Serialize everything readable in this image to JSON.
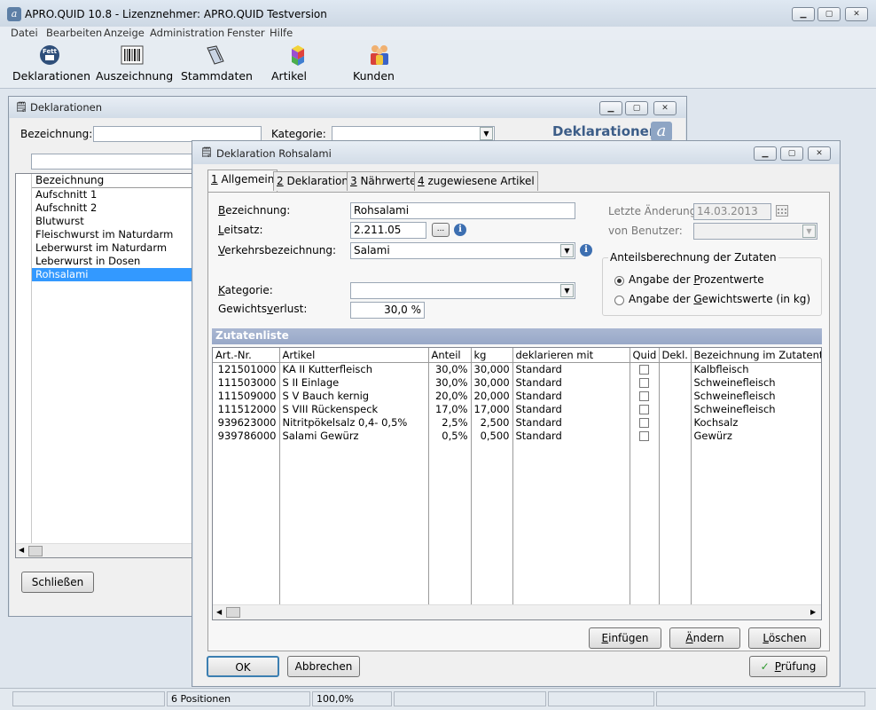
{
  "app": {
    "title": "APRO.QUID 10.8 - Lizenznehmer: APRO.QUID Testversion",
    "icon_letter": "a"
  },
  "menu": [
    "Datei",
    "Bearbeiten",
    "Anzeige",
    "Administration",
    "Fenster",
    "Hilfe"
  ],
  "toolbar": [
    {
      "label": "Deklarationen",
      "icon": "fett-badge-icon"
    },
    {
      "label": "Auszeichnung",
      "icon": "barcode-icon"
    },
    {
      "label": "Stammdaten",
      "icon": "folder-tag-icon"
    },
    {
      "label": "Artikel",
      "icon": "cubes-icon"
    },
    {
      "label": "Kunden",
      "icon": "people-icon"
    }
  ],
  "list_window": {
    "title": "Deklarationen",
    "bezeichnung_label": "Bezeichnung:",
    "kategorie_label": "Kategorie:",
    "brand_text": "Deklarationen",
    "column_header": "Bezeichnung",
    "items": [
      "Aufschnitt 1",
      "Aufschnitt 2",
      "Blutwurst",
      "Fleischwurst im Naturdarm",
      "Leberwurst im Naturdarm",
      "Leberwurst in Dosen",
      "Rohsalami"
    ],
    "selected_index": 6,
    "close_button": "Schließen"
  },
  "dialog": {
    "title": "Deklaration Rohsalami",
    "tabs": [
      {
        "key": "1",
        "label": " Allgemein"
      },
      {
        "key": "2",
        "label": " Deklaration"
      },
      {
        "key": "3",
        "label": " Nährwerte"
      },
      {
        "key": "4",
        "label": " zugewiesene Artikel"
      }
    ],
    "form": {
      "bezeichnung_label_u": "B",
      "bezeichnung_label_rest": "ezeichnung:",
      "bezeichnung_value": "Rohsalami",
      "leitsatz_label_u": "L",
      "leitsatz_label_rest": "eitsatz:",
      "leitsatz_value": "2.211.05",
      "leitsatz_browse": "...",
      "verkehr_label_u": "V",
      "verkehr_label_rest": "erkehrsbezeichnung:",
      "verkehr_value": "Salami",
      "kategorie_label_u": "K",
      "kategorie_label_rest": "ategorie:",
      "kategorie_value": "",
      "gewicht_label_pre": "Gewichts",
      "gewicht_label_u": "v",
      "gewicht_label_rest": "erlust:",
      "gewicht_value": "30,0 %",
      "letzte_label": "Letzte Änderung:",
      "letzte_value": "14.03.2013",
      "benutzer_label": "von Benutzer:",
      "benutzer_value": ""
    },
    "anteil": {
      "title": "Anteilsberechnung der Zutaten",
      "opt1_pre": "Angabe der ",
      "opt1_u": "P",
      "opt1_rest": "rozentwerte",
      "opt2_pre": "Angabe der ",
      "opt2_u": "G",
      "opt2_rest": "ewichtswerte (in kg)",
      "selected": 1
    },
    "zutaten": {
      "header": "Zutatenliste",
      "columns": [
        "Art.-Nr.",
        "Artikel",
        "Anteil",
        "kg",
        "deklarieren mit",
        "Quid",
        "Dekl.",
        "Bezeichnung im Zutatentext"
      ],
      "rows": [
        {
          "nr": "121501000",
          "artikel": "KA II Kutterfleisch",
          "anteil": "30,0%",
          "kg": "30,000",
          "dekl": "Standard",
          "bez": "Kalbfleisch"
        },
        {
          "nr": "111503000",
          "artikel": "S II Einlage",
          "anteil": "30,0%",
          "kg": "30,000",
          "dekl": "Standard",
          "bez": "Schweinefleisch"
        },
        {
          "nr": "111509000",
          "artikel": "S V Bauch kernig",
          "anteil": "20,0%",
          "kg": "20,000",
          "dekl": "Standard",
          "bez": "Schweinefleisch"
        },
        {
          "nr": "111512000",
          "artikel": "S VIII Rückenspeck",
          "anteil": "17,0%",
          "kg": "17,000",
          "dekl": "Standard",
          "bez": "Schweinefleisch"
        },
        {
          "nr": "939623000",
          "artikel": "Nitritpökelsalz 0,4- 0,5%",
          "anteil": "2,5%",
          "kg": "2,500",
          "dekl": "Standard",
          "bez": "Kochsalz"
        },
        {
          "nr": "939786000",
          "artikel": "Salami Gewürz",
          "anteil": "0,5%",
          "kg": "0,500",
          "dekl": "Standard",
          "bez": "Gewürz"
        }
      ],
      "btn_insert_u": "E",
      "btn_insert_rest": "infügen",
      "btn_change_u": "Ä",
      "btn_change_rest": "ndern",
      "btn_delete_u": "L",
      "btn_delete_rest": "öschen"
    },
    "ok": "OK",
    "cancel": "Abbrechen",
    "check_u": "P",
    "check_rest": "rüfung"
  },
  "status": {
    "positions": "6 Positionen",
    "zoom": "100,0%"
  }
}
